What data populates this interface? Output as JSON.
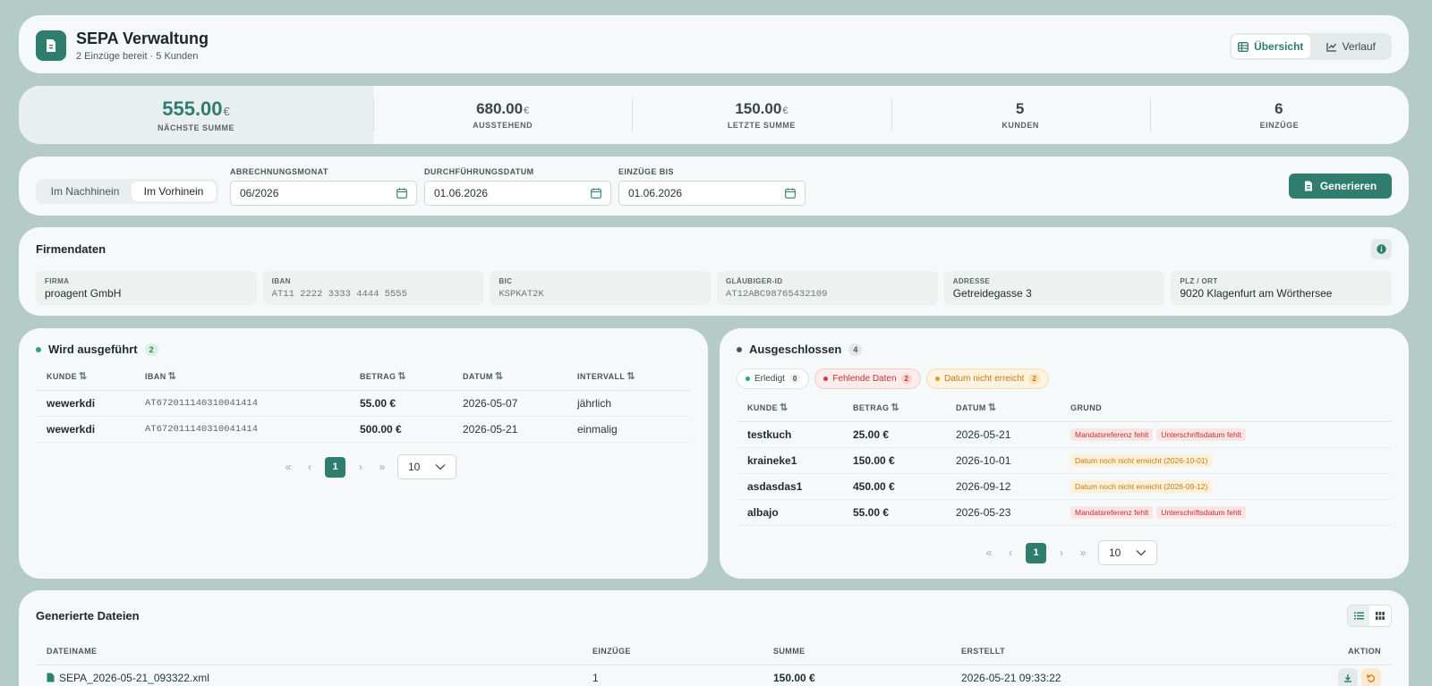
{
  "header": {
    "title": "SEPA Verwaltung",
    "subtitle": "2 Einzüge bereit · 5 Kunden",
    "tabs": [
      {
        "label": "Übersicht"
      },
      {
        "label": "Verlauf"
      }
    ]
  },
  "stats": [
    {
      "value": "555.00",
      "currency": "€",
      "label": "NÄCHSTE SUMME"
    },
    {
      "value": "680.00",
      "currency": "€",
      "label": "AUSSTEHEND"
    },
    {
      "value": "150.00",
      "currency": "€",
      "label": "LETZTE SUMME"
    },
    {
      "value": "5",
      "currency": "",
      "label": "KUNDEN"
    },
    {
      "value": "6",
      "currency": "",
      "label": "EINZÜGE"
    }
  ],
  "filter": {
    "modes": [
      {
        "label": "Im Nachhinein"
      },
      {
        "label": "Im Vorhinein"
      }
    ],
    "fields": [
      {
        "label": "ABRECHNUNGSMONAT",
        "value": "06/2026"
      },
      {
        "label": "DURCHFÜHRUNGSDATUM",
        "value": "01.06.2026"
      },
      {
        "label": "EINZÜGE BIS",
        "value": "01.06.2026"
      }
    ],
    "generate_label": "Generieren"
  },
  "firm": {
    "title": "Firmendaten",
    "fields": [
      {
        "label": "FIRMA",
        "value": "proagent GmbH"
      },
      {
        "label": "IBAN",
        "value": "AT11 2222 3333 4444 5555"
      },
      {
        "label": "BIC",
        "value": "KSPKAT2K"
      },
      {
        "label": "GLÄUBIGER-ID",
        "value": "AT12ABC98765432109"
      },
      {
        "label": "ADRESSE",
        "value": "Getreidegasse 3"
      },
      {
        "label": "PLZ / ORT",
        "value": "9020 Klagenfurt am Wörthersee"
      }
    ]
  },
  "executed": {
    "title": "Wird ausgeführt",
    "count": "2",
    "columns": [
      "KUNDE",
      "IBAN",
      "BETRAG",
      "DATUM",
      "INTERVALL"
    ],
    "rows": [
      {
        "kunde": "wewerkdi",
        "iban": "AT672011140310041414",
        "betrag": "55.00 €",
        "datum": "2026-05-07",
        "intervall": "jährlich"
      },
      {
        "kunde": "wewerkdi",
        "iban": "AT672011140310041414",
        "betrag": "500.00 €",
        "datum": "2026-05-21",
        "intervall": "einmalig"
      }
    ],
    "page": "1",
    "page_size": "10"
  },
  "excluded": {
    "title": "Ausgeschlossen",
    "count": "4",
    "filters": [
      {
        "label": "Erledigt",
        "count": "0"
      },
      {
        "label": "Fehlende Daten",
        "count": "2"
      },
      {
        "label": "Datum nicht erreicht",
        "count": "2"
      }
    ],
    "columns": [
      "KUNDE",
      "BETRAG",
      "DATUM",
      "GRUND"
    ],
    "rows": [
      {
        "kunde": "testkuch",
        "betrag": "25.00 €",
        "datum": "2026-05-21",
        "reasons": [
          {
            "text": "Mandatsreferenz fehlt",
            "kind": "red"
          },
          {
            "text": "Unterschriftsdatum fehlt",
            "kind": "red"
          }
        ]
      },
      {
        "kunde": "kraineke1",
        "betrag": "150.00 €",
        "datum": "2026-10-01",
        "reasons": [
          {
            "text": "Datum noch nicht erreicht (2026-10-01)",
            "kind": "orange"
          }
        ]
      },
      {
        "kunde": "asdasdas1",
        "betrag": "450.00 €",
        "datum": "2026-09-12",
        "reasons": [
          {
            "text": "Datum noch nicht erreicht (2026-09-12)",
            "kind": "orange"
          }
        ]
      },
      {
        "kunde": "albajo",
        "betrag": "55.00 €",
        "datum": "2026-05-23",
        "reasons": [
          {
            "text": "Mandatsreferenz fehlt",
            "kind": "red"
          },
          {
            "text": "Unterschriftsdatum fehlt",
            "kind": "red"
          }
        ]
      }
    ],
    "page": "1",
    "page_size": "10"
  },
  "files": {
    "title": "Generierte Dateien",
    "columns": [
      "DATEINAME",
      "EINZÜGE",
      "SUMME",
      "ERSTELLT",
      "AKTION"
    ],
    "rows": [
      {
        "name": "SEPA_2026-05-21_093322.xml",
        "einzuege": "1",
        "summe": "150.00 €",
        "erstellt": "2026-05-21 09:33:22"
      }
    ]
  },
  "colors": {
    "accent": "#2e7d6e",
    "background": "#b5cbc8",
    "card": "#f6f9f9",
    "error": "#c23333",
    "warning": "#c97a10"
  },
  "icons": [
    "document-icon",
    "table-icon",
    "chart-icon",
    "calendar-icon",
    "info-icon",
    "sort-icon",
    "chevron-down-icon",
    "list-view-icon",
    "grid-view-icon",
    "download-icon",
    "undo-icon",
    "file-icon"
  ]
}
